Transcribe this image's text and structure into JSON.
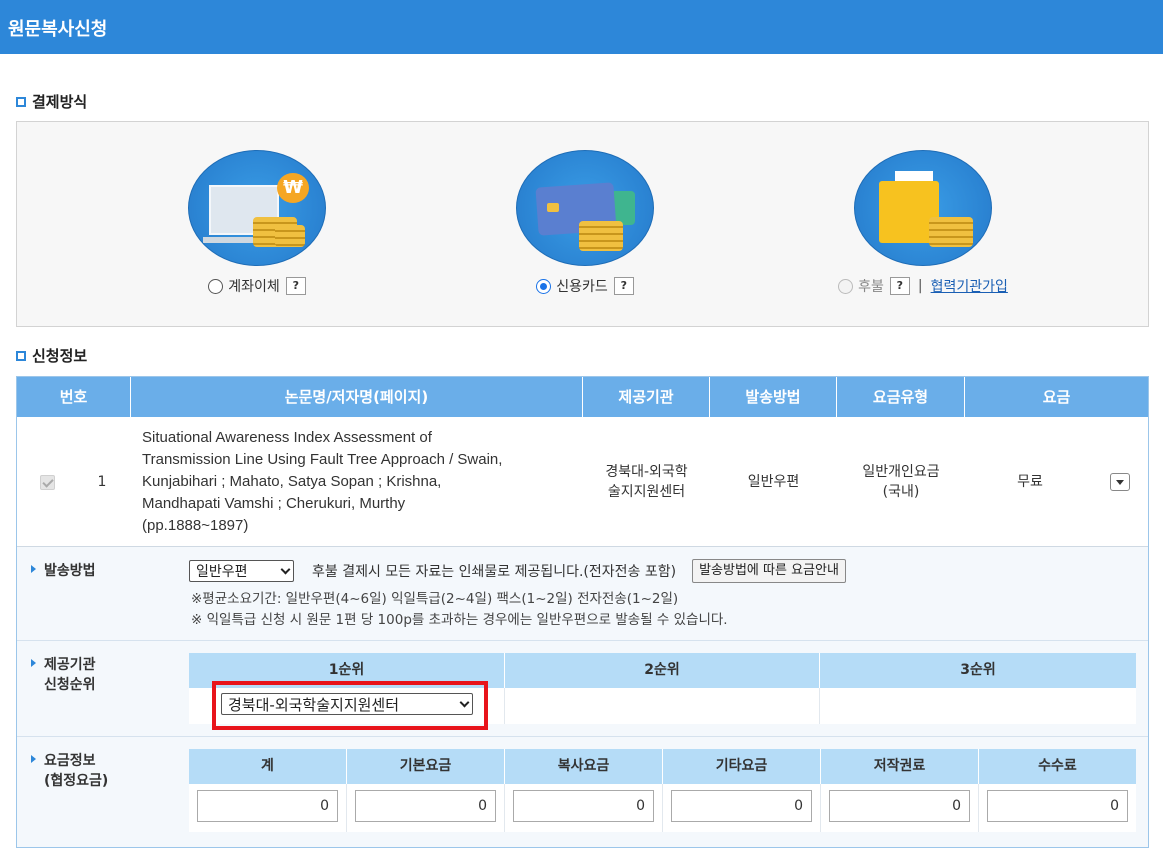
{
  "window": {
    "title": "원문복사신청"
  },
  "payment": {
    "section_title": "결제방식",
    "options": [
      {
        "label": "계좌이체",
        "selected": false,
        "disabled": false,
        "help": "?"
      },
      {
        "label": "신용카드",
        "selected": true,
        "disabled": false,
        "help": "?"
      },
      {
        "label": "후불",
        "selected": false,
        "disabled": true,
        "help": "?"
      }
    ],
    "separator": "|",
    "join_link": "협력기관가입",
    "icons": {
      "bubble_symbol": "₩"
    }
  },
  "request": {
    "section_title": "신청정보",
    "headers": [
      "번호",
      "논문명/저자명(페이지)",
      "제공기관",
      "발송방법",
      "요금유형",
      "요금"
    ],
    "row": {
      "no": "1",
      "title_lines": [
        "Situational Awareness Index Assessment of",
        "Transmission Line Using Fault Tree Approach / Swain,",
        "Kunjabihari ; Mahato, Satya Sopan ; Krishna,",
        "Mandhapati Vamshi ; Cherukuri, Murthy",
        "(pp.1888~1897)"
      ],
      "provider_lines": [
        "경북대-외국학",
        "술지지원센터"
      ],
      "method": "일반우편",
      "fee_type_lines": [
        "일반개인요금",
        "(국내)"
      ],
      "fee": "무료"
    },
    "shipping": {
      "label": "발송방법",
      "selected": "일반우편",
      "note": "후불 결제시 모든 자료는 인쇄물로 제공됩니다.(전자전송 포함)",
      "button": "발송방법에 따른 요금안내",
      "info1": "※평균소요기간: 일반우편(4~6일) 익일특급(2~4일) 팩스(1~2일) 전자전송(1~2일)",
      "info2": "※ 익일특급 신청 시 원문 1편 당 100p를 초과하는 경우에는 일반우편으로 발송될 수 있습니다."
    },
    "provider_order": {
      "label_lines": [
        "제공기관",
        "신청순위"
      ],
      "headers": [
        "1순위",
        "2순위",
        "3순위"
      ],
      "selected": "경북대-외국학술지지원센터"
    },
    "fees": {
      "label_lines": [
        "요금정보",
        "(협정요금)"
      ],
      "headers": [
        "계",
        "기본요금",
        "복사요금",
        "기타요금",
        "저작권료",
        "수수료"
      ],
      "values": [
        "0",
        "0",
        "0",
        "0",
        "0",
        "0"
      ]
    }
  },
  "colors": {
    "header_blue": "#2d87d9",
    "table_head": "#6aaee9",
    "grid_head": "#b5dcf7",
    "highlight": "#e8141b"
  }
}
